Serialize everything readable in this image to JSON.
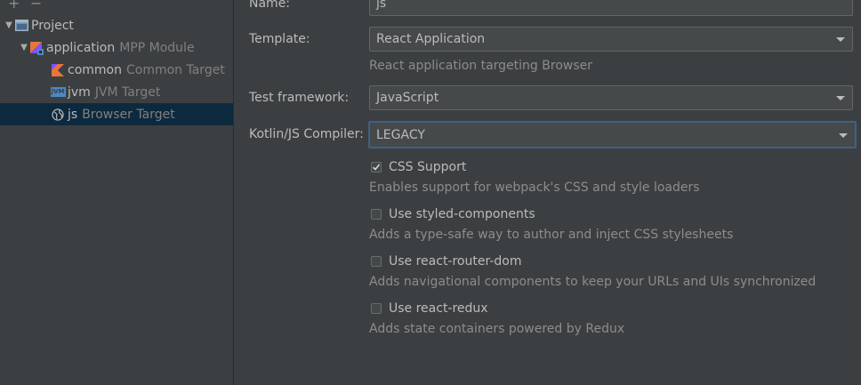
{
  "toolbar": {
    "add_label": "+",
    "remove_label": "−"
  },
  "tree": {
    "project": {
      "name": "Project"
    },
    "application": {
      "name": "application",
      "sub": "MPP Module"
    },
    "targets": [
      {
        "name": "common",
        "sub": "Common Target",
        "icon": "kotlin-icon"
      },
      {
        "name": "jvm",
        "sub": "JVM Target",
        "icon": "jvm-icon",
        "icon_text": "JVM"
      },
      {
        "name": "js",
        "sub": "Browser Target",
        "icon": "globe-icon",
        "selected": true
      }
    ]
  },
  "form": {
    "name_label": "Name:",
    "name_value": "js",
    "template_label": "Template:",
    "template_value": "React Application",
    "template_desc": "React application targeting Browser",
    "test_label": "Test framework:",
    "test_value": "JavaScript",
    "compiler_label": "Kotlin/JS Compiler:",
    "compiler_value": "LEGACY"
  },
  "options": [
    {
      "label": "CSS Support",
      "checked": true,
      "desc": "Enables support for webpack's CSS and style loaders"
    },
    {
      "label": "Use styled-components",
      "checked": false,
      "desc": "Adds a type-safe way to author and inject CSS stylesheets"
    },
    {
      "label": "Use react-router-dom",
      "checked": false,
      "desc": "Adds navigational components to keep your URLs and UIs synchronized"
    },
    {
      "label": "Use react-redux",
      "checked": false,
      "desc": "Adds state containers powered by Redux"
    }
  ],
  "colors": {
    "background": "#3c3f41",
    "selection": "#0d293e",
    "focus_border": "#3d6185",
    "kotlin_accent": "#e8753a"
  }
}
